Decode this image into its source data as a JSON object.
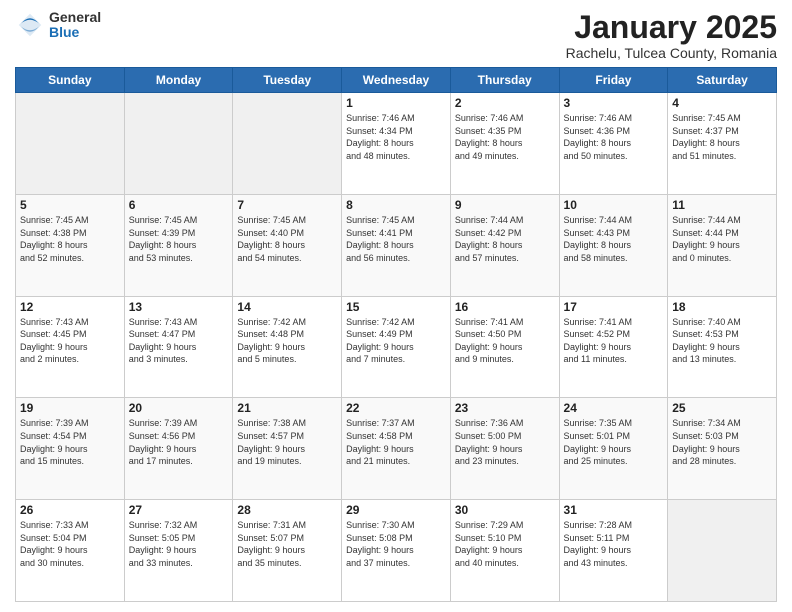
{
  "logo": {
    "general": "General",
    "blue": "Blue"
  },
  "header": {
    "title": "January 2025",
    "location": "Rachelu, Tulcea County, Romania"
  },
  "weekdays": [
    "Sunday",
    "Monday",
    "Tuesday",
    "Wednesday",
    "Thursday",
    "Friday",
    "Saturday"
  ],
  "weeks": [
    [
      {
        "day": "",
        "sunrise": "",
        "sunset": "",
        "daylight": ""
      },
      {
        "day": "",
        "sunrise": "",
        "sunset": "",
        "daylight": ""
      },
      {
        "day": "",
        "sunrise": "",
        "sunset": "",
        "daylight": ""
      },
      {
        "day": "1",
        "sunrise": "Sunrise: 7:46 AM",
        "sunset": "Sunset: 4:34 PM",
        "daylight": "Daylight: 8 hours and 48 minutes."
      },
      {
        "day": "2",
        "sunrise": "Sunrise: 7:46 AM",
        "sunset": "Sunset: 4:35 PM",
        "daylight": "Daylight: 8 hours and 49 minutes."
      },
      {
        "day": "3",
        "sunrise": "Sunrise: 7:46 AM",
        "sunset": "Sunset: 4:36 PM",
        "daylight": "Daylight: 8 hours and 50 minutes."
      },
      {
        "day": "4",
        "sunrise": "Sunrise: 7:45 AM",
        "sunset": "Sunset: 4:37 PM",
        "daylight": "Daylight: 8 hours and 51 minutes."
      }
    ],
    [
      {
        "day": "5",
        "sunrise": "Sunrise: 7:45 AM",
        "sunset": "Sunset: 4:38 PM",
        "daylight": "Daylight: 8 hours and 52 minutes."
      },
      {
        "day": "6",
        "sunrise": "Sunrise: 7:45 AM",
        "sunset": "Sunset: 4:39 PM",
        "daylight": "Daylight: 8 hours and 53 minutes."
      },
      {
        "day": "7",
        "sunrise": "Sunrise: 7:45 AM",
        "sunset": "Sunset: 4:40 PM",
        "daylight": "Daylight: 8 hours and 54 minutes."
      },
      {
        "day": "8",
        "sunrise": "Sunrise: 7:45 AM",
        "sunset": "Sunset: 4:41 PM",
        "daylight": "Daylight: 8 hours and 56 minutes."
      },
      {
        "day": "9",
        "sunrise": "Sunrise: 7:44 AM",
        "sunset": "Sunset: 4:42 PM",
        "daylight": "Daylight: 8 hours and 57 minutes."
      },
      {
        "day": "10",
        "sunrise": "Sunrise: 7:44 AM",
        "sunset": "Sunset: 4:43 PM",
        "daylight": "Daylight: 8 hours and 58 minutes."
      },
      {
        "day": "11",
        "sunrise": "Sunrise: 7:44 AM",
        "sunset": "Sunset: 4:44 PM",
        "daylight": "Daylight: 9 hours and 0 minutes."
      }
    ],
    [
      {
        "day": "12",
        "sunrise": "Sunrise: 7:43 AM",
        "sunset": "Sunset: 4:45 PM",
        "daylight": "Daylight: 9 hours and 2 minutes."
      },
      {
        "day": "13",
        "sunrise": "Sunrise: 7:43 AM",
        "sunset": "Sunset: 4:47 PM",
        "daylight": "Daylight: 9 hours and 3 minutes."
      },
      {
        "day": "14",
        "sunrise": "Sunrise: 7:42 AM",
        "sunset": "Sunset: 4:48 PM",
        "daylight": "Daylight: 9 hours and 5 minutes."
      },
      {
        "day": "15",
        "sunrise": "Sunrise: 7:42 AM",
        "sunset": "Sunset: 4:49 PM",
        "daylight": "Daylight: 9 hours and 7 minutes."
      },
      {
        "day": "16",
        "sunrise": "Sunrise: 7:41 AM",
        "sunset": "Sunset: 4:50 PM",
        "daylight": "Daylight: 9 hours and 9 minutes."
      },
      {
        "day": "17",
        "sunrise": "Sunrise: 7:41 AM",
        "sunset": "Sunset: 4:52 PM",
        "daylight": "Daylight: 9 hours and 11 minutes."
      },
      {
        "day": "18",
        "sunrise": "Sunrise: 7:40 AM",
        "sunset": "Sunset: 4:53 PM",
        "daylight": "Daylight: 9 hours and 13 minutes."
      }
    ],
    [
      {
        "day": "19",
        "sunrise": "Sunrise: 7:39 AM",
        "sunset": "Sunset: 4:54 PM",
        "daylight": "Daylight: 9 hours and 15 minutes."
      },
      {
        "day": "20",
        "sunrise": "Sunrise: 7:39 AM",
        "sunset": "Sunset: 4:56 PM",
        "daylight": "Daylight: 9 hours and 17 minutes."
      },
      {
        "day": "21",
        "sunrise": "Sunrise: 7:38 AM",
        "sunset": "Sunset: 4:57 PM",
        "daylight": "Daylight: 9 hours and 19 minutes."
      },
      {
        "day": "22",
        "sunrise": "Sunrise: 7:37 AM",
        "sunset": "Sunset: 4:58 PM",
        "daylight": "Daylight: 9 hours and 21 minutes."
      },
      {
        "day": "23",
        "sunrise": "Sunrise: 7:36 AM",
        "sunset": "Sunset: 5:00 PM",
        "daylight": "Daylight: 9 hours and 23 minutes."
      },
      {
        "day": "24",
        "sunrise": "Sunrise: 7:35 AM",
        "sunset": "Sunset: 5:01 PM",
        "daylight": "Daylight: 9 hours and 25 minutes."
      },
      {
        "day": "25",
        "sunrise": "Sunrise: 7:34 AM",
        "sunset": "Sunset: 5:03 PM",
        "daylight": "Daylight: 9 hours and 28 minutes."
      }
    ],
    [
      {
        "day": "26",
        "sunrise": "Sunrise: 7:33 AM",
        "sunset": "Sunset: 5:04 PM",
        "daylight": "Daylight: 9 hours and 30 minutes."
      },
      {
        "day": "27",
        "sunrise": "Sunrise: 7:32 AM",
        "sunset": "Sunset: 5:05 PM",
        "daylight": "Daylight: 9 hours and 33 minutes."
      },
      {
        "day": "28",
        "sunrise": "Sunrise: 7:31 AM",
        "sunset": "Sunset: 5:07 PM",
        "daylight": "Daylight: 9 hours and 35 minutes."
      },
      {
        "day": "29",
        "sunrise": "Sunrise: 7:30 AM",
        "sunset": "Sunset: 5:08 PM",
        "daylight": "Daylight: 9 hours and 37 minutes."
      },
      {
        "day": "30",
        "sunrise": "Sunrise: 7:29 AM",
        "sunset": "Sunset: 5:10 PM",
        "daylight": "Daylight: 9 hours and 40 minutes."
      },
      {
        "day": "31",
        "sunrise": "Sunrise: 7:28 AM",
        "sunset": "Sunset: 5:11 PM",
        "daylight": "Daylight: 9 hours and 43 minutes."
      },
      {
        "day": "",
        "sunrise": "",
        "sunset": "",
        "daylight": ""
      }
    ]
  ]
}
